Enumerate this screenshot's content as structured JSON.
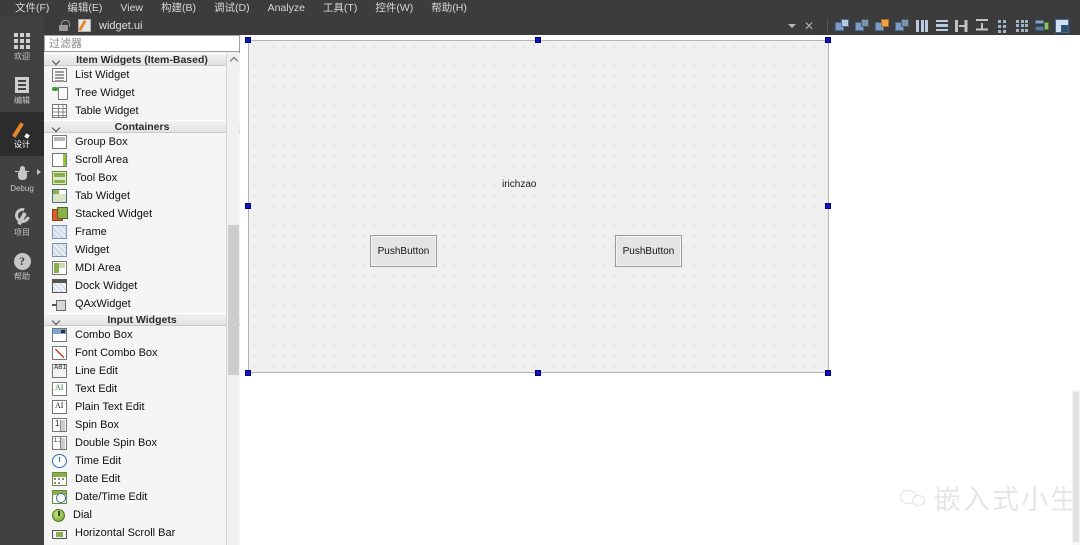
{
  "menubar": {
    "items": [
      {
        "label": "文件(F)"
      },
      {
        "label": "编辑(E)"
      },
      {
        "label": "View"
      },
      {
        "label": "构建(B)"
      },
      {
        "label": "调试(D)"
      },
      {
        "label": "Analyze"
      },
      {
        "label": "工具(T)"
      },
      {
        "label": "控件(W)"
      },
      {
        "label": "帮助(H)"
      }
    ]
  },
  "modebar": {
    "items": [
      {
        "label": "欢迎",
        "icon": "grid-icon",
        "active": false
      },
      {
        "label": "编辑",
        "icon": "document-icon",
        "active": false
      },
      {
        "label": "设计",
        "icon": "pencil-icon",
        "active": true
      },
      {
        "label": "Debug",
        "icon": "bug-icon",
        "active": false
      },
      {
        "label": "项目",
        "icon": "wrench-icon",
        "active": false
      },
      {
        "label": "帮助",
        "icon": "question-mark-icon",
        "active": false
      }
    ]
  },
  "editor_toolbar": {
    "filename": "widget.ui",
    "lock_icon": "unlocked-padlock-icon",
    "file_icon": "ui-file-icon",
    "dropdown_icon": "chevron-down-icon",
    "close_icon": "close-x-icon",
    "layout_tools": [
      {
        "name": "break-layout-icon"
      },
      {
        "name": "adjust-size-icon"
      },
      {
        "name": "lay-out-horizontally-icon"
      },
      {
        "name": "lay-out-vertically-icon"
      },
      {
        "name": "lay-out-in-splitter-horizontal-icon"
      },
      {
        "name": "lay-out-in-splitter-vertical-icon"
      },
      {
        "name": "lay-out-in-grid-icon"
      },
      {
        "name": "lay-out-in-form-icon"
      },
      {
        "name": "edit-tab-order-icon"
      },
      {
        "name": "edit-buddies-icon"
      },
      {
        "name": "edit-signals-slots-icon"
      },
      {
        "name": "preview-icon"
      }
    ]
  },
  "widget_box": {
    "filter_placeholder": "过滤器",
    "filter_value": "",
    "groups": [
      {
        "title": "Item Widgets (Item-Based)",
        "expanded": true,
        "items": [
          {
            "label": "List Widget",
            "icon": "list-widget-icon"
          },
          {
            "label": "Tree Widget",
            "icon": "tree-widget-icon"
          },
          {
            "label": "Table Widget",
            "icon": "table-widget-icon"
          }
        ]
      },
      {
        "title": "Containers",
        "expanded": true,
        "items": [
          {
            "label": "Group Box",
            "icon": "group-box-icon"
          },
          {
            "label": "Scroll Area",
            "icon": "scroll-area-icon"
          },
          {
            "label": "Tool Box",
            "icon": "tool-box-icon"
          },
          {
            "label": "Tab Widget",
            "icon": "tab-widget-icon"
          },
          {
            "label": "Stacked Widget",
            "icon": "stacked-widget-icon"
          },
          {
            "label": "Frame",
            "icon": "frame-icon"
          },
          {
            "label": "Widget",
            "icon": "widget-icon"
          },
          {
            "label": "MDI Area",
            "icon": "mdi-area-icon"
          },
          {
            "label": "Dock Widget",
            "icon": "dock-widget-icon"
          },
          {
            "label": "QAxWidget",
            "icon": "qaxwidget-icon"
          }
        ]
      },
      {
        "title": "Input Widgets",
        "expanded": true,
        "items": [
          {
            "label": "Combo Box",
            "icon": "combo-box-icon"
          },
          {
            "label": "Font Combo Box",
            "icon": "font-combo-box-icon"
          },
          {
            "label": "Line Edit",
            "icon": "line-edit-icon"
          },
          {
            "label": "Text Edit",
            "icon": "text-edit-icon"
          },
          {
            "label": "Plain Text Edit",
            "icon": "plain-text-edit-icon"
          },
          {
            "label": "Spin Box",
            "icon": "spin-box-icon"
          },
          {
            "label": "Double Spin Box",
            "icon": "double-spin-box-icon"
          },
          {
            "label": "Time Edit",
            "icon": "time-edit-icon"
          },
          {
            "label": "Date Edit",
            "icon": "date-edit-icon"
          },
          {
            "label": "Date/Time Edit",
            "icon": "date-time-edit-icon"
          },
          {
            "label": "Dial",
            "icon": "dial-icon"
          },
          {
            "label": "Horizontal Scroll Bar",
            "icon": "horizontal-scroll-bar-icon"
          }
        ]
      }
    ]
  },
  "canvas": {
    "form_selected": true,
    "label": "irichzao",
    "buttons": [
      {
        "label": "PushButton"
      },
      {
        "label": "PushButton"
      }
    ]
  },
  "watermark": {
    "text": "嵌入式小生",
    "logo": "wechat-logo-icon"
  },
  "colors": {
    "menu_bg": "#3c3c3c",
    "mode_bg": "#414141",
    "mode_active_bg": "#2c2c2c",
    "accent_orange": "#e8862a",
    "selection_handle": "#1414b4",
    "canvas_bg": "#f0f0f0"
  }
}
